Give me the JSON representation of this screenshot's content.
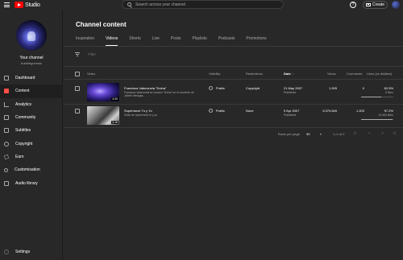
{
  "app": {
    "brand": "Studio",
    "brand_color": "#ff0000"
  },
  "search": {
    "placeholder": "Search across your channel"
  },
  "header": {
    "create_label": "Create",
    "help_label": "?"
  },
  "sidebar": {
    "channel_label": "Your channel",
    "channel_name": "bubbleguminiz",
    "items": [
      {
        "label": "Dashboard",
        "icon": "dashboard-icon"
      },
      {
        "label": "Content",
        "icon": "content-icon",
        "active": true
      },
      {
        "label": "Analytics",
        "icon": "analytics-icon"
      },
      {
        "label": "Community",
        "icon": "community-icon"
      },
      {
        "label": "Subtitles",
        "icon": "subtitles-icon"
      },
      {
        "label": "Copyright",
        "icon": "copyright-icon"
      },
      {
        "label": "Earn",
        "icon": "earn-icon"
      },
      {
        "label": "Customisation",
        "icon": "customisation-icon"
      },
      {
        "label": "Audio library",
        "icon": "audio-library-icon"
      }
    ],
    "settings_label": "Settings"
  },
  "main": {
    "title": "Channel content",
    "tabs": [
      "Inspiration",
      "Videos",
      "Shorts",
      "Live",
      "Posts",
      "Playlists",
      "Podcasts",
      "Promotions"
    ],
    "active_tab": "Videos",
    "filter_label": "Filter",
    "columns": {
      "video": "Video",
      "visibility": "Visibility",
      "restrictions": "Restrictions",
      "date": "Date",
      "date_sort": "↓",
      "views": "Views",
      "comments": "Comments",
      "likes": "Likes (vs dislikes)"
    },
    "rows": [
      {
        "title": "Francisca Valenzuela \"Dolna\"",
        "desc": "Francisca Valenzuela la Canción \"Dolna\" en el concierto de Juliete Venegas...",
        "duration": "4:30",
        "visibility": "Public",
        "restrictions": "Copyright",
        "date": "21 May 2007",
        "date_status": "Published",
        "views": "1,909",
        "comments": "0",
        "likes_pct": "62.5%",
        "likes_count": "5 likes",
        "likes_ratio": 0.625
      },
      {
        "title": "Supermeze Tu y Yo",
        "desc": "Video de supermeze tu y yo",
        "duration": "3:18",
        "visibility": "Public",
        "restrictions": "None",
        "date": "9 Apr 2007",
        "date_status": "Published",
        "views": "3,370,849",
        "comments": "1,203",
        "likes_pct": "97.2%",
        "likes_count": "13,963 likes",
        "likes_ratio": 0.972
      }
    ],
    "pager": {
      "rows_label": "Rows per page:",
      "rows_value": "30",
      "caret": "▾",
      "range": "1–2 of 2",
      "first": "|<",
      "prev": "<",
      "next": ">",
      "last": ">|"
    }
  }
}
